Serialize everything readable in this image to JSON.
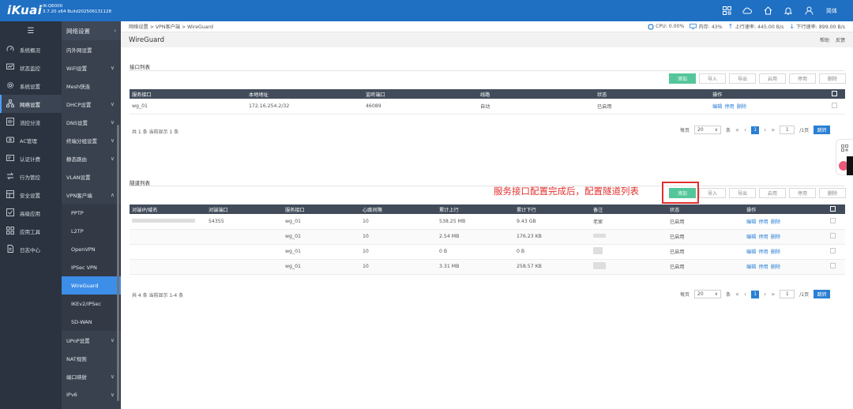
{
  "header": {
    "logo": "iKuai",
    "model": "IK-Q6000",
    "version": "3.7.20 x64 Build202506131128",
    "lang": "简体"
  },
  "nav_main": {
    "items": [
      {
        "label": "系统概况",
        "icon": "gauge-icon"
      },
      {
        "label": "状态监控",
        "icon": "monitor-icon"
      },
      {
        "label": "系统设置",
        "icon": "gear-icon"
      },
      {
        "label": "网络设置",
        "icon": "network-icon"
      },
      {
        "label": "流控分流",
        "icon": "flow-icon"
      },
      {
        "label": "AC管理",
        "icon": "ac-icon"
      },
      {
        "label": "认证计费",
        "icon": "auth-icon"
      },
      {
        "label": "行为管控",
        "icon": "behavior-icon"
      },
      {
        "label": "安全设置",
        "icon": "security-icon"
      },
      {
        "label": "高级应用",
        "icon": "advanced-icon"
      },
      {
        "label": "应用工具",
        "icon": "tools-icon"
      },
      {
        "label": "日志中心",
        "icon": "log-icon"
      }
    ]
  },
  "nav_sub": {
    "title": "网络设置",
    "items": [
      {
        "label": "内外网设置",
        "chevron": ""
      },
      {
        "label": "WiFi设置",
        "chevron": "∨"
      },
      {
        "label": "Mesh快连",
        "chevron": ""
      },
      {
        "label": "DHCP设置",
        "chevron": "∨"
      },
      {
        "label": "DNS设置",
        "chevron": "∨"
      },
      {
        "label": "终端分组设置",
        "chevron": "∨"
      },
      {
        "label": "静态路由",
        "chevron": "∨"
      },
      {
        "label": "VLAN设置",
        "chevron": ""
      },
      {
        "label": "VPN客户端",
        "chevron": "∧"
      }
    ],
    "vpn_items": [
      "PPTP",
      "L2TP",
      "OpenVPN",
      "IPSec VPN",
      "WireGuard",
      "IKEv2/IPSec",
      "SD-WAN"
    ],
    "after_items": [
      {
        "label": "UPnP设置",
        "chevron": "∨"
      },
      {
        "label": "NAT规则",
        "chevron": ""
      },
      {
        "label": "端口映射",
        "chevron": "∨"
      },
      {
        "label": "IPv6",
        "chevron": "∨"
      },
      {
        "label": "IGMP代理",
        "chevron": ""
      }
    ]
  },
  "breadcrumb": "网络设置 > VPN客户端 > WireGuard",
  "stats": {
    "cpu": "CPU: 0.00%",
    "mem": "内存: 43%",
    "up": "上行速率: 445.00 B/s",
    "down": "下行速率: 899.00 B/s"
  },
  "page": {
    "title": "WireGuard",
    "help": "帮助",
    "feedback": "反馈"
  },
  "buttons": {
    "add": "添加",
    "import": "导入",
    "export": "导出",
    "enable": "启用",
    "disable": "停用",
    "delete": "删除"
  },
  "iface": {
    "label": "接口列表",
    "columns": [
      "服务接口",
      "本地地址",
      "监听端口",
      "线路",
      "状态",
      "操作"
    ],
    "rows": [
      {
        "name": "wg_01",
        "addr": "172.16.254.2/32",
        "port": "46089",
        "line": "自动",
        "status": "已启用"
      }
    ],
    "footer": "共 1 条 当前显示 1 条"
  },
  "tunnel": {
    "label": "隧道列表",
    "columns": [
      "对端IP/域名",
      "对端端口",
      "服务接口",
      "心跳间隔",
      "累计上行",
      "累计下行",
      "备注",
      "状态",
      "操作"
    ],
    "rows": [
      {
        "port": "54355",
        "iface": "wg_01",
        "hb": "10",
        "up": "538.25 MB",
        "down": "9.43 GB",
        "note": "老家",
        "status": "已启用"
      },
      {
        "port": "",
        "iface": "wg_01",
        "hb": "10",
        "up": "2.54 MB",
        "down": "176.23 KB",
        "note": "",
        "status": "已启用"
      },
      {
        "port": "",
        "iface": "wg_01",
        "hb": "10",
        "up": "0 B",
        "down": "0 B",
        "note": "",
        "status": "已启用"
      },
      {
        "port": "",
        "iface": "wg_01",
        "hb": "10",
        "up": "3.31 MB",
        "down": "258.57 KB",
        "note": "",
        "status": "已启用"
      }
    ],
    "footer": "共 4 条 当前显示 1-4 条"
  },
  "ops": {
    "edit": "编辑",
    "disable": "停用",
    "delete": "删除"
  },
  "pagination": {
    "per_page_label": "每页",
    "per_page": "20",
    "unit": "条",
    "page": "1",
    "current": "1",
    "total": "/1页",
    "go": "跳转"
  },
  "annotation": "服务接口配置完成后，配置隧道列表",
  "colors": {
    "accent": "#1f6fc3",
    "add": "#54c69a",
    "enabled": "#3fbb5d",
    "annot": "#e0302e"
  }
}
